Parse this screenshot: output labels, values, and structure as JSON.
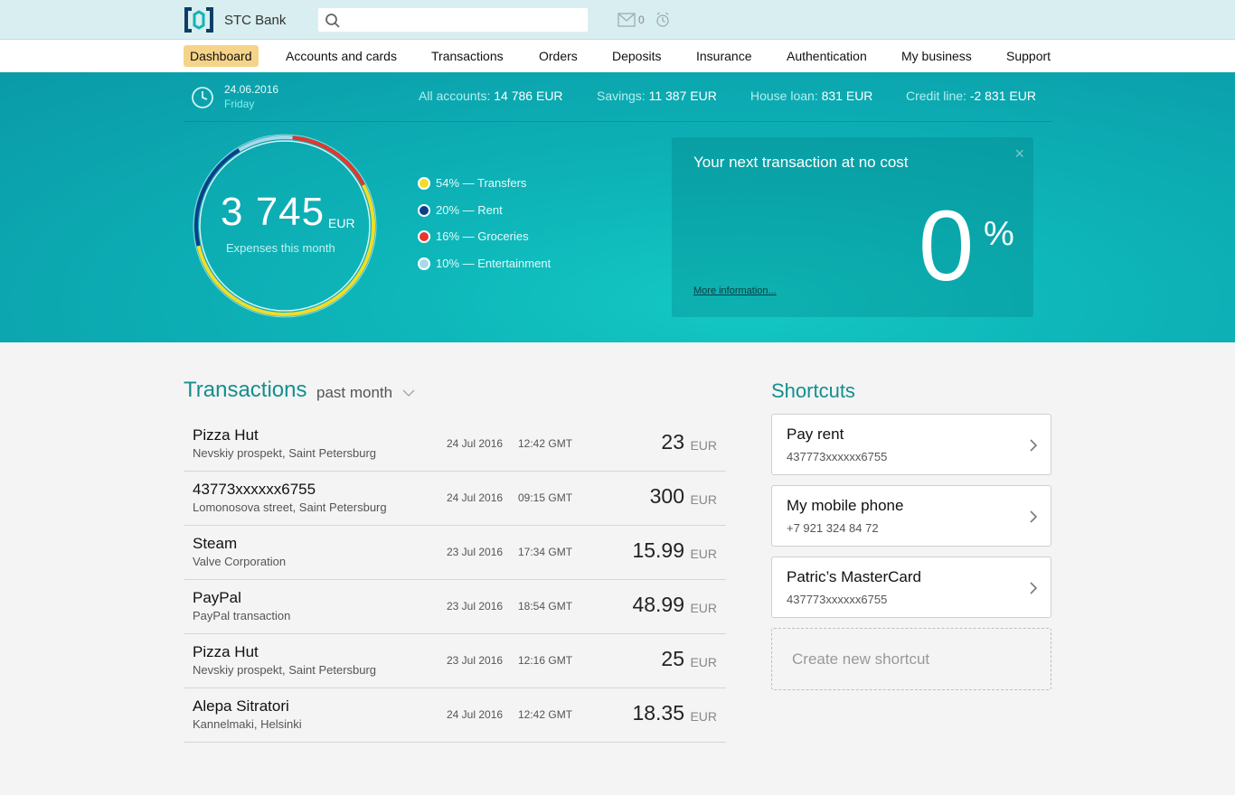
{
  "header": {
    "brand": "STC Bank",
    "search_placeholder": "",
    "mail_count": "0",
    "icons": [
      "logo-icon",
      "search-icon",
      "mail-icon",
      "alarm-icon"
    ]
  },
  "nav": {
    "items": [
      "Dashboard",
      "Accounts and cards",
      "Transactions",
      "Orders",
      "Deposits",
      "Insurance",
      "Authentication",
      "My business",
      "Support"
    ],
    "active": "Dashboard"
  },
  "summary": {
    "date": "24.06.2016",
    "weekday": "Friday",
    "accounts": [
      {
        "label": "All accounts:",
        "value": "14 786 EUR"
      },
      {
        "label": "Savings:",
        "value": "11 387 EUR"
      },
      {
        "label": "House loan:",
        "value": "831 EUR"
      },
      {
        "label": "Credit line:",
        "value": "-2 831 EUR"
      }
    ]
  },
  "expenses": {
    "amount": "3 745",
    "currency": "EUR",
    "caption": "Expenses this month",
    "breakdown": [
      {
        "percent": 54,
        "text": "54% — Transfers",
        "color": "#f2dd27"
      },
      {
        "percent": 20,
        "text": "20% — Rent",
        "color": "#0c3f8a"
      },
      {
        "percent": 16,
        "text": "16% — Groceries",
        "color": "#e6362a"
      },
      {
        "percent": 10,
        "text": "10% — Entertainment",
        "color": "#a9d8ec"
      }
    ]
  },
  "promo": {
    "title": "Your next transaction at no cost",
    "link": "More information...",
    "value": "0",
    "unit": "%",
    "close": "×"
  },
  "transactions": {
    "title": "Transactions",
    "period": "past month",
    "rows": [
      {
        "name": "Pizza Hut",
        "place": "Nevskiy prospekt, Saint Petersburg",
        "date": "24 Jul 2016",
        "time": "12:42 GMT",
        "amount": "23",
        "currency": "EUR"
      },
      {
        "name": "43773xxxxxx6755",
        "place": "Lomonosova street,  Saint Petersburg",
        "date": "24 Jul 2016",
        "time": "09:15 GMT",
        "amount": "300",
        "currency": "EUR"
      },
      {
        "name": "Steam",
        "place": "Valve Corporation",
        "date": "23 Jul 2016",
        "time": "17:34 GMT",
        "amount": "15.99",
        "currency": "EUR"
      },
      {
        "name": "PayPal",
        "place": "PayPal transaction",
        "date": "23 Jul 2016",
        "time": "18:54 GMT",
        "amount": "48.99",
        "currency": "EUR"
      },
      {
        "name": "Pizza Hut",
        "place": "Nevskiy prospekt,  Saint Petersburg",
        "date": "23 Jul 2016",
        "time": "12:16 GMT",
        "amount": "25",
        "currency": "EUR"
      },
      {
        "name": "Alepa Sitratori",
        "place": "Kannelmaki, Helsinki",
        "date": "24 Jul 2016",
        "time": "12:42 GMT",
        "amount": "18.35",
        "currency": "EUR"
      }
    ]
  },
  "shortcuts": {
    "title": "Shortcuts",
    "items": [
      {
        "name": "Pay rent",
        "sub": "437773xxxxxx6755"
      },
      {
        "name": "My mobile phone",
        "sub": "+7 921 324 84 72"
      },
      {
        "name": "Patric’s MasterCard",
        "sub": "437773xxxxxx6755"
      }
    ],
    "create_label": "Create new shortcut"
  }
}
